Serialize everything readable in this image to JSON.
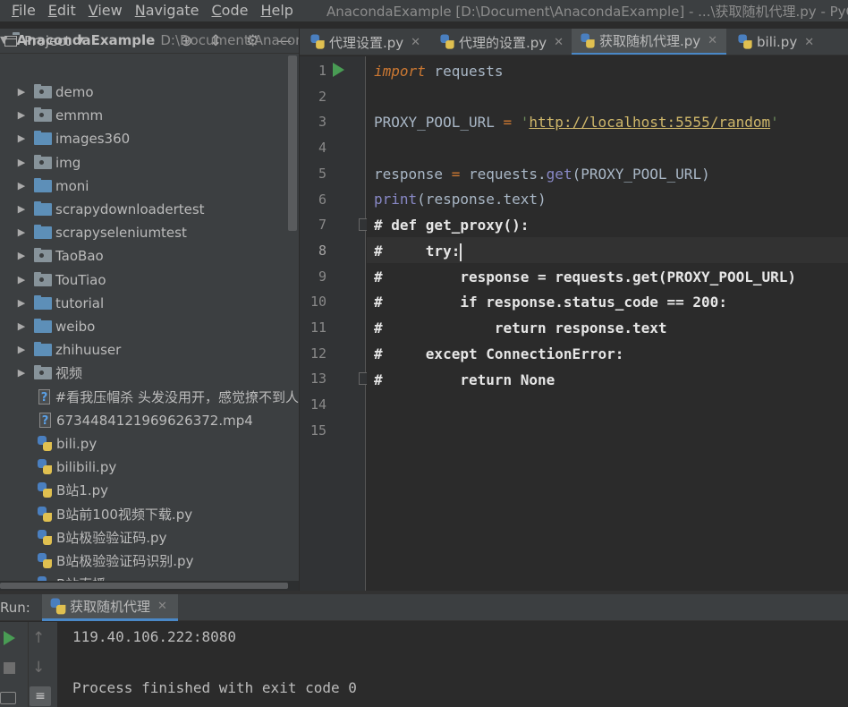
{
  "menu": {
    "items": [
      "File",
      "Edit",
      "View",
      "Navigate",
      "Code",
      "Help"
    ],
    "window_title": "AnacondaExample [D:\\Document\\AnacondaExample] - ...\\获取随机代理.py - PyCharm"
  },
  "project_panel": {
    "title": "Project",
    "root": {
      "name": "AnacondaExample",
      "path": "D:\\Document\\AnacondaExample"
    },
    "items": [
      {
        "label": "demo",
        "type": "folder-plain"
      },
      {
        "label": "emmm",
        "type": "folder-plain"
      },
      {
        "label": "images360",
        "type": "folder"
      },
      {
        "label": "img",
        "type": "folder-plain"
      },
      {
        "label": "moni",
        "type": "folder"
      },
      {
        "label": "scrapydownloadertest",
        "type": "folder"
      },
      {
        "label": "scrapyseleniumtest",
        "type": "folder"
      },
      {
        "label": "TaoBao",
        "type": "folder-plain"
      },
      {
        "label": "TouTiao",
        "type": "folder-plain"
      },
      {
        "label": "tutorial",
        "type": "folder"
      },
      {
        "label": "weibo",
        "type": "folder"
      },
      {
        "label": "zhihuuser",
        "type": "folder"
      },
      {
        "label": "视频",
        "type": "folder-plain"
      },
      {
        "label": "#看我压帽杀 头发没用开，感觉撩不到人",
        "type": "file-unknown"
      },
      {
        "label": "6734484121969626372.mp4",
        "type": "file-unknown"
      },
      {
        "label": "bili.py",
        "type": "file-py"
      },
      {
        "label": "bilibili.py",
        "type": "file-py"
      },
      {
        "label": "B站1.py",
        "type": "file-py"
      },
      {
        "label": "B站前100视频下载.py",
        "type": "file-py"
      },
      {
        "label": "B站极验验证码.py",
        "type": "file-py"
      },
      {
        "label": "B站极验验证码识别.py",
        "type": "file-py"
      },
      {
        "label": "B站直播.py",
        "type": "file-py"
      }
    ]
  },
  "editor": {
    "tabs": [
      {
        "label": "代理设置.py",
        "active": false
      },
      {
        "label": "代理的设置.py",
        "active": false
      },
      {
        "label": "获取随机代理.py",
        "active": true
      },
      {
        "label": "bili.py",
        "active": false
      }
    ],
    "line_numbers": [
      "1",
      "2",
      "3",
      "4",
      "5",
      "6",
      "7",
      "8",
      "9",
      "10",
      "11",
      "12",
      "13",
      "14",
      "15"
    ],
    "current_line": 8,
    "code": {
      "l1_kw": "import",
      "l1_rest": " requests",
      "l3_name": "PROXY_POOL_URL ",
      "l3_eq": "=",
      "l3_q1": " '",
      "l3_url": "http://localhost:5555/random",
      "l3_q2": "'",
      "l5_name": "response ",
      "l5_eq": "=",
      "l5_obj": " requests.",
      "l5_fn": "get",
      "l5_args": "(PROXY_POOL_URL)",
      "l6_fn": "print",
      "l6_args": "(response.text)",
      "l7": "# def get_proxy():",
      "l8": "#     try:",
      "l9": "#         response = requests.get(PROXY_POOL_URL)",
      "l10": "#         if response.status_code == 200:",
      "l11": "#             return response.text",
      "l12": "#     except ConnectionError:",
      "l13": "#         return None"
    }
  },
  "run_panel": {
    "label": "Run:",
    "tab_label": "获取随机代理",
    "output": [
      "119.40.106.222:8080",
      "",
      "Process finished with exit code 0"
    ]
  },
  "colors": {
    "background": "#2b2b2b",
    "panel": "#3c3f41",
    "keyword": "#cc7832",
    "string": "#6a8759",
    "accent": "#4a88c7",
    "run_green": "#499c54"
  }
}
